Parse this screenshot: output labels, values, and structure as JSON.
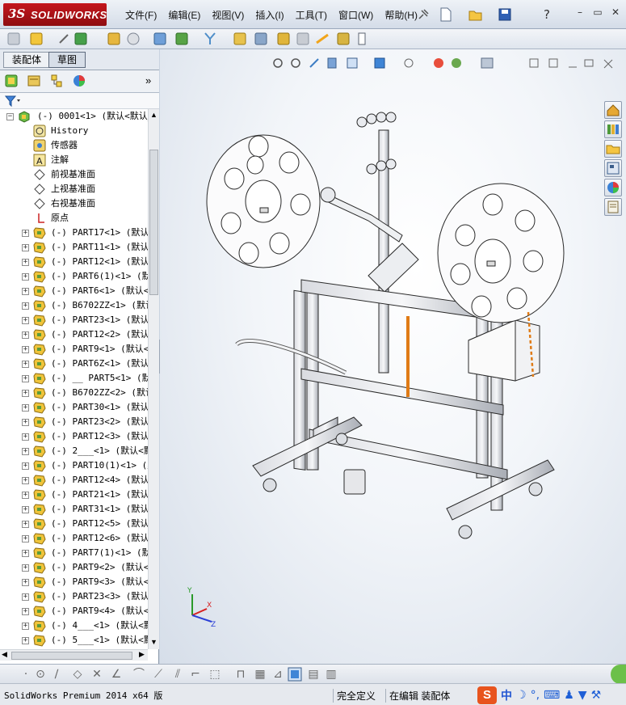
{
  "app": {
    "logo_ds": "3S",
    "logo_text": "SOLIDWORKS"
  },
  "menu": [
    "文件(F)",
    "编辑(E)",
    "视图(V)",
    "插入(I)",
    "工具(T)",
    "窗口(W)",
    "帮助(H)"
  ],
  "left_panel": {
    "tabs": [
      "装配体",
      "草图"
    ],
    "tree_root": "(-) 0001<1> (默认<默认_",
    "features": [
      {
        "label": "History",
        "icon": "history-icon"
      },
      {
        "label": "传感器",
        "icon": "sensor-icon"
      },
      {
        "label": "注解",
        "icon": "annotation-icon"
      },
      {
        "label": "前视基准面",
        "icon": "plane-icon"
      },
      {
        "label": "上视基准面",
        "icon": "plane-icon"
      },
      {
        "label": "右视基准面",
        "icon": "plane-icon"
      },
      {
        "label": "原点",
        "icon": "origin-icon"
      }
    ],
    "parts": [
      "(-) PART17<1> (默认<",
      "(-) PART11<1> (默认<",
      "(-) PART12<1> (默认<",
      "(-) PART6(1)<1> (默认",
      "(-) PART6<1> (默认<<",
      "(-) B6702ZZ<1> (默认",
      "(-) PART23<1> (默认<",
      "(-) PART12<2> (默认<",
      "(-) PART9<1> (默认<<",
      "(-) PART6Z<1> (默认<",
      "(-) __ PART5<1> (默认",
      "(-) B6702ZZ<2> (默认",
      "(-) PART30<1> (默认<",
      "(-) PART23<2> (默认<",
      "(-) PART12<3> (默认<",
      "(-) 2___<1> (默认<默",
      "(-) PART10(1)<1> (默",
      "(-) PART12<4> (默认<",
      "(-) PART21<1> (默认<",
      "(-) PART31<1> (默认<",
      "(-) PART12<5> (默认<",
      "(-) PART12<6> (默认<",
      "(-) PART7(1)<1> (默认",
      "(-) PART9<2> (默认<<",
      "(-) PART9<3> (默认<<",
      "(-) PART23<3> (默认<",
      "(-) PART9<4> (默认<<",
      "(-) 4___<1> (默认<默",
      "(-) 5___<1> (默认<默"
    ]
  },
  "status": {
    "left": "SolidWorks Premium 2014 x64 版",
    "cells": [
      "完全定义",
      "在编辑 装配体"
    ]
  },
  "ime": {
    "label": "中"
  },
  "colors": {
    "brand": "#c4161c",
    "frame": "#b9bcc3",
    "accent_orange": "#e07b16"
  }
}
